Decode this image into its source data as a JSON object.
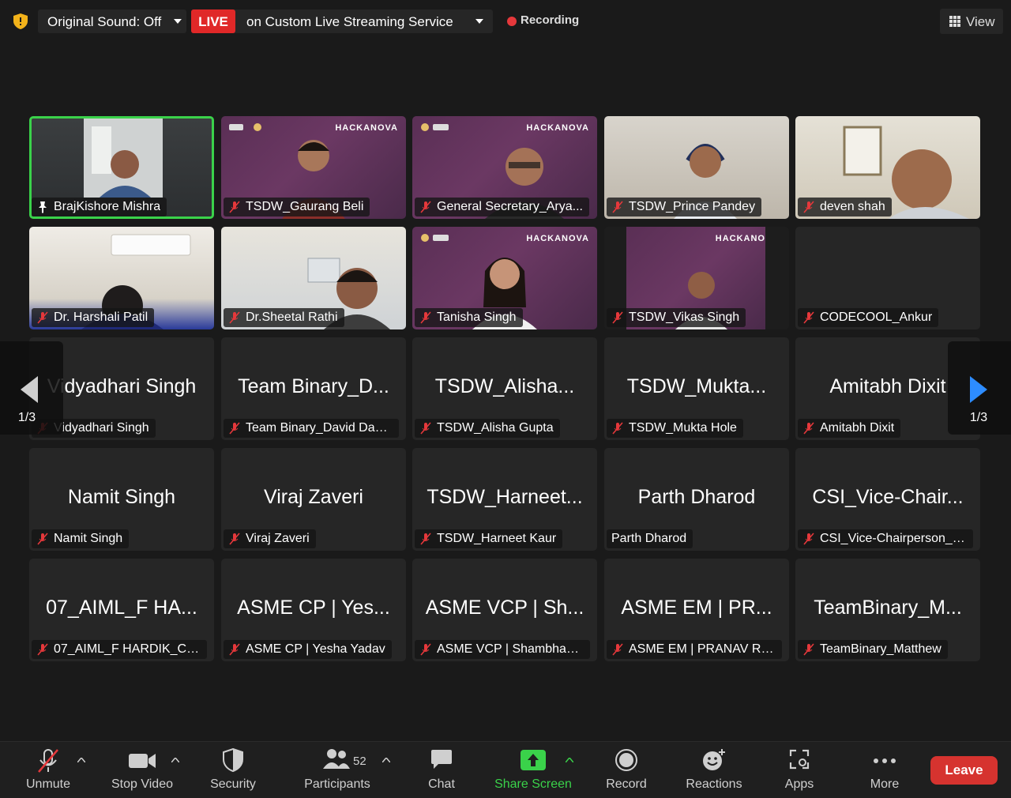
{
  "top_bar": {
    "original_sound": "Original Sound: Off",
    "live_badge": "LIVE",
    "live_text": "on Custom Live Streaming Service",
    "recording": "Recording",
    "view": "View"
  },
  "tiles": [
    {
      "caption": "BrajKishore Mishra"
    },
    {
      "caption": "TSDW_Gaurang Beli",
      "brand": "HACKANOVA"
    },
    {
      "caption": "General Secretary_Arya...",
      "brand": "HACKANOVA"
    },
    {
      "caption": "TSDW_Prince Pandey"
    },
    {
      "caption": "deven shah"
    },
    {
      "caption": "Dr. Harshali Patil"
    },
    {
      "caption": "Dr.Sheetal Rathi"
    },
    {
      "caption": "Tanisha Singh",
      "brand": "HACKANOVA"
    },
    {
      "caption": "TSDW_Vikas Singh",
      "brand": "HACKANO"
    },
    {
      "caption": "CODECOOL_Ankur"
    },
    {
      "big": "Vidyadhari Singh",
      "caption": "Vidyadhari Singh"
    },
    {
      "big": "Team Binary_D...",
      "caption": "Team Binary_David Dabr..."
    },
    {
      "big": "TSDW_Alisha...",
      "caption": "TSDW_Alisha Gupta"
    },
    {
      "big": "TSDW_Mukta...",
      "caption": "TSDW_Mukta Hole"
    },
    {
      "big": "Amitabh Dixit",
      "caption": "Amitabh Dixit"
    },
    {
      "big": "Namit Singh",
      "caption": "Namit Singh"
    },
    {
      "big": "Viraj Zaveri",
      "caption": "Viraj Zaveri"
    },
    {
      "big": "TSDW_Harneet...",
      "caption": "TSDW_Harneet Kaur"
    },
    {
      "big": "Parth Dharod",
      "caption": "Parth Dharod"
    },
    {
      "big": "CSI_Vice-Chair...",
      "caption": "CSI_Vice-Chairperson_A..."
    },
    {
      "big": "07_AIML_F HA...",
      "caption": "07_AIML_F HARDIK_CHE..."
    },
    {
      "big": "ASME CP | Yes...",
      "caption": "ASME CP | Yesha Yadav"
    },
    {
      "big": "ASME VCP | Sh...",
      "caption": "ASME VCP | Shambhavi..."
    },
    {
      "big": "ASME EM | PR...",
      "caption": "ASME EM | PRANAV RA..."
    },
    {
      "big": "TeamBinary_M...",
      "caption": "TeamBinary_Matthew"
    }
  ],
  "pagination": {
    "left": "1/3",
    "right": "1/3"
  },
  "toolbar": {
    "unmute": "Unmute",
    "stop_video": "Stop Video",
    "security": "Security",
    "participants": "Participants",
    "participants_count": "52",
    "chat": "Chat",
    "share_screen": "Share Screen",
    "record": "Record",
    "reactions": "Reactions",
    "apps": "Apps",
    "more": "More",
    "leave": "Leave"
  },
  "colors": {
    "background": "#1a1a1a",
    "tile": "#262626",
    "live": "#e02828",
    "active_speaker": "#3ad24a",
    "share": "#3ad24a",
    "leave": "#d6332f",
    "mute_icon": "#e5383b"
  }
}
